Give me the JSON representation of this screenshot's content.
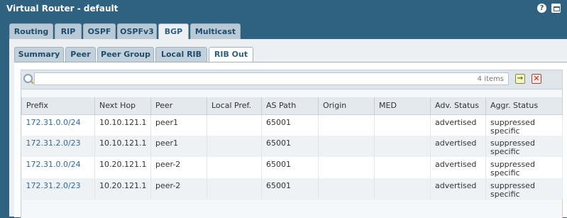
{
  "window": {
    "title": "Virtual Router - default"
  },
  "icons": {
    "help": "help-icon",
    "maximize": "maximize-icon",
    "search": "search-icon",
    "apply": "apply-filter-icon",
    "clear": "clear-filter-icon"
  },
  "main_tabs": [
    {
      "label": "Routing",
      "active": false
    },
    {
      "label": "RIP",
      "active": false
    },
    {
      "label": "OSPF",
      "active": false
    },
    {
      "label": "OSPFv3",
      "active": false
    },
    {
      "label": "BGP",
      "active": true
    },
    {
      "label": "Multicast",
      "active": false
    }
  ],
  "sub_tabs": [
    {
      "label": "Summary",
      "active": false
    },
    {
      "label": "Peer",
      "active": false
    },
    {
      "label": "Peer Group",
      "active": false
    },
    {
      "label": "Local RIB",
      "active": false
    },
    {
      "label": "RIB Out",
      "active": true
    }
  ],
  "search": {
    "value": "",
    "count_label": "4 items"
  },
  "table": {
    "columns": [
      "Prefix",
      "Next Hop",
      "Peer",
      "Local Pref.",
      "AS Path",
      "Origin",
      "MED",
      "Adv. Status",
      "Aggr. Status"
    ],
    "rows": [
      [
        "172.31.0.0/24",
        "10.10.121.1",
        "peer1",
        "",
        "65001",
        "",
        "",
        "advertised",
        "suppressed\nspecific"
      ],
      [
        "172.31.2.0/23",
        "10.10.121.1",
        "peer1",
        "",
        "65001",
        "",
        "",
        "advertised",
        "suppressed\nspecific"
      ],
      [
        "172.31.0.0/24",
        "10.20.121.1",
        "peer-2",
        "",
        "65001",
        "",
        "",
        "advertised",
        "suppressed\nspecific"
      ],
      [
        "172.31.2.0/23",
        "10.20.121.1",
        "peer-2",
        "",
        "65001",
        "",
        "",
        "advertised",
        "suppressed\nspecific"
      ]
    ]
  }
}
